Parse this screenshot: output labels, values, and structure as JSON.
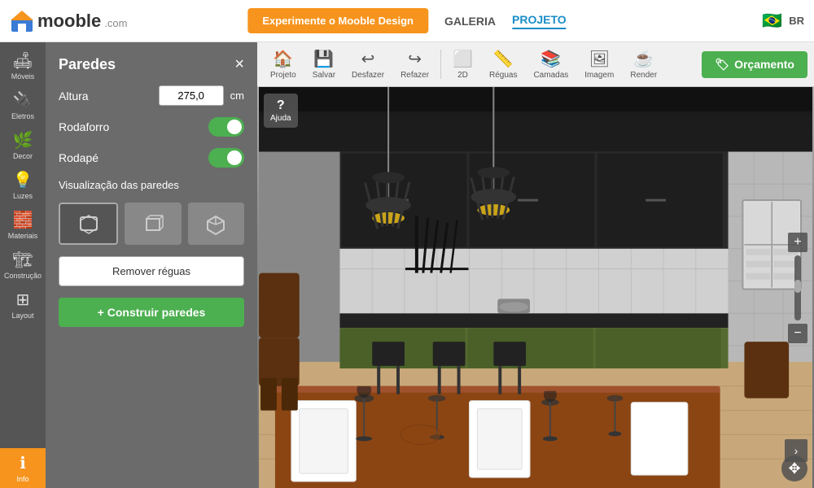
{
  "header": {
    "logo_text": "mooble",
    "logo_suffix": ".com",
    "btn_experimente": "Experimente o Mooble Design",
    "nav_galeria": "GALERIA",
    "nav_projeto": "PROJETO",
    "flag": "🇧🇷",
    "lang": "BR"
  },
  "sidebar": {
    "items": [
      {
        "id": "moveis",
        "label": "Móveis",
        "icon": "🛋"
      },
      {
        "id": "eletros",
        "label": "Eletros",
        "icon": "🔌"
      },
      {
        "id": "decor",
        "label": "Decor",
        "icon": "🌿"
      },
      {
        "id": "luzes",
        "label": "Luzes",
        "icon": "💡"
      },
      {
        "id": "materiais",
        "label": "Materiais",
        "icon": "🧱"
      },
      {
        "id": "construcao",
        "label": "Construção",
        "icon": "🏗"
      },
      {
        "id": "layout",
        "label": "Layout",
        "icon": "⊞"
      },
      {
        "id": "info",
        "label": "Info",
        "icon": "ℹ"
      }
    ]
  },
  "panel": {
    "title": "Paredes",
    "close_label": "×",
    "height_label": "Altura",
    "height_value": "275,0",
    "height_unit": "cm",
    "rodaforro_label": "Rodaforro",
    "rodape_label": "Rodapé",
    "vis_label": "Visualização das paredes",
    "btn_remover": "Remover réguas",
    "btn_construir": "+ Construir paredes"
  },
  "toolbar": {
    "tools": [
      {
        "id": "projeto",
        "label": "Projeto",
        "icon": "🏠"
      },
      {
        "id": "salvar",
        "label": "Salvar",
        "icon": "💾"
      },
      {
        "id": "desfazer",
        "label": "Desfazer",
        "icon": "↩"
      },
      {
        "id": "refazer",
        "label": "Refazer",
        "icon": "↪"
      },
      {
        "id": "2d",
        "label": "2D",
        "icon": "⬜"
      },
      {
        "id": "reguas",
        "label": "Réguas",
        "icon": "📏"
      },
      {
        "id": "camadas",
        "label": "Camadas",
        "icon": "📚"
      },
      {
        "id": "imagem",
        "label": "Imagem",
        "icon": "🖼"
      },
      {
        "id": "render",
        "label": "Render",
        "icon": "☕"
      }
    ],
    "btn_orcamento": "Orçamento",
    "orcamento_icon": "🏷"
  },
  "ajuda": {
    "label": "Ajuda",
    "icon": "?"
  },
  "zoom": {
    "plus": "+",
    "minus": "−"
  }
}
